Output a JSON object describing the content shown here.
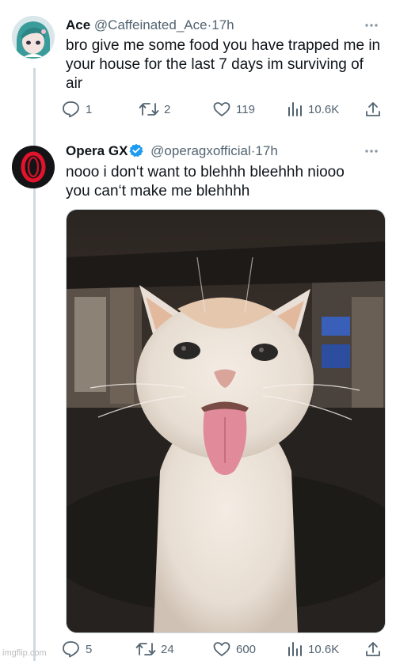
{
  "tweets": [
    {
      "name": "Ace",
      "handle": "@Caffeinated_Ace",
      "time": "17h",
      "text_lines": [
        "bro give me some food you have trapped me in",
        "your house for the last 7 days im surviving of",
        "air"
      ],
      "replies": "1",
      "retweets": "2",
      "likes": "119",
      "views": "10.6K"
    },
    {
      "name": "Opera GX",
      "handle": "@operagxofficial",
      "time": "17h",
      "verified": true,
      "text_lines": [
        "nooo i don‘t want to blehhh bleehhh niooo",
        "you can‘t make me blehhhh"
      ],
      "replies": "5",
      "retweets": "24",
      "likes": "600",
      "views": "10.6K"
    }
  ],
  "separator": "·",
  "more_icon": "more-dots-icon",
  "watermark": "imgflip.com",
  "colors": {
    "text": "#0f1419",
    "secondary": "#536471",
    "verified": "#1d9bf0",
    "thread_line": "#cfd9de",
    "opera_red": "#e3132b"
  }
}
